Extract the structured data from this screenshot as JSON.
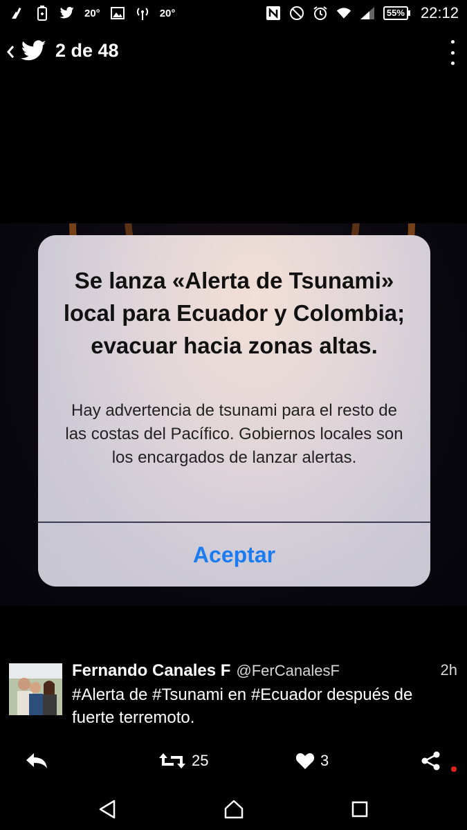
{
  "status_bar": {
    "left_icons": [
      "cleaner-icon",
      "battery-saver-icon",
      "twitter-icon",
      "weather-icon",
      "image-icon",
      "hotspot-icon",
      "weather-icon"
    ],
    "temp1": "20°",
    "temp2": "20°",
    "battery": "55%",
    "time": "22:12"
  },
  "header": {
    "counter": "2 de 48"
  },
  "alert": {
    "title": "Se lanza «Alerta de Tsunami» local para Ecuador y Colombia; evacuar hacia zonas altas.",
    "message": "Hay advertencia de tsunami para el resto de las costas del Pacífico. Gobiernos locales son los encargados de lanzar alertas.",
    "button": "Aceptar",
    "button_color": "#1a7cf0"
  },
  "tweet": {
    "name": "Fernando Canales F",
    "handle": "@FerCanalesF",
    "time": "2h",
    "text": "#Alerta de #Tsunami en #Ecuador después de fuerte terremoto."
  },
  "actions": {
    "retweets": "25",
    "likes": "3"
  },
  "colors": {
    "background": "#000000",
    "notification_dot": "#e3201c"
  }
}
